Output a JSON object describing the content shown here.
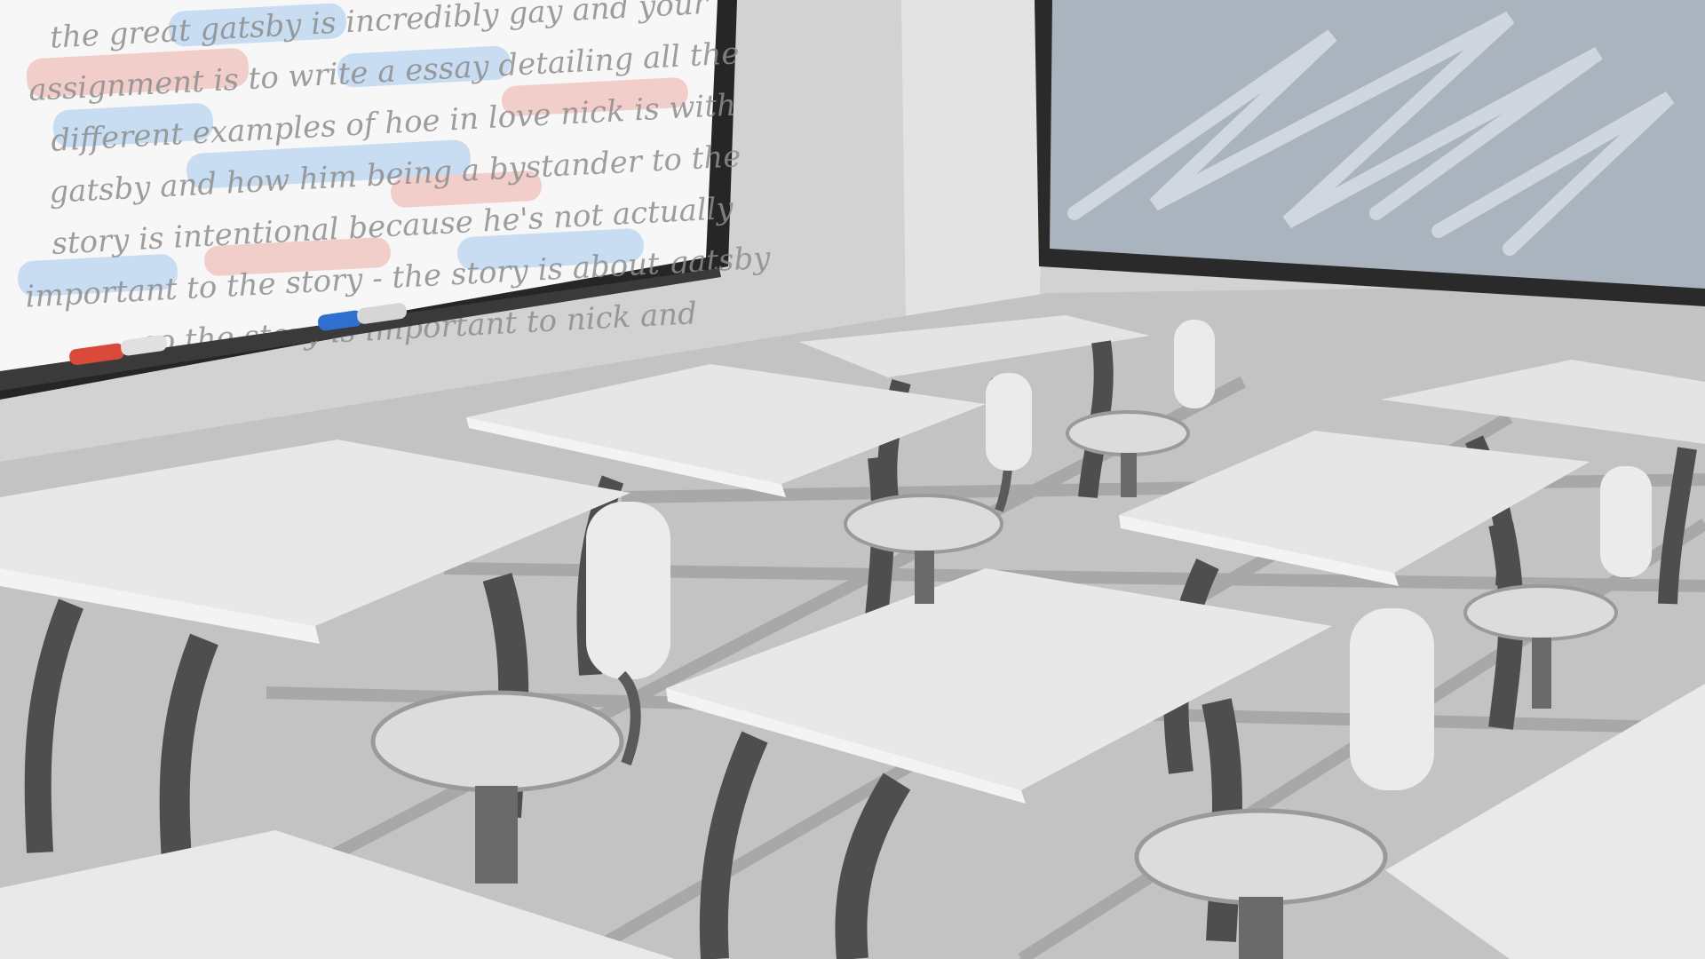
{
  "whiteboard": {
    "lines": [
      "the great gatsby is incredibly gay and your",
      "assignment is to write a essay detailing all the",
      "different examples of hoe in love nick is with",
      "gatsby and how him being a bystander to the",
      "story is intentional because he's not actually",
      "important to the story - the story is about gatsby",
      "so the story is important to nick and"
    ],
    "markers": [
      {
        "name": "red-marker",
        "color": "#d94a3a"
      },
      {
        "name": "blue-marker",
        "color": "#2f6fd0"
      }
    ],
    "highlights": {
      "blue": "#b9d4f0",
      "red": "#f1c1bb"
    }
  },
  "palette": {
    "wall": "#d6d6d6",
    "floor": "#bdbdbd",
    "desk_top": "#e4e4e4",
    "desk_edge": "#f2f2f2",
    "legs": "#4e4e4e",
    "seat": "#dcdcdc",
    "frame": "#333333",
    "window_glass": "#a9b4bf"
  }
}
